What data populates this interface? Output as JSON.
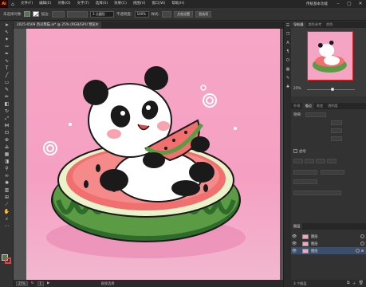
{
  "app": {
    "logo": "Ai"
  },
  "menu": {
    "items": [
      "文件(F)",
      "编辑(E)",
      "对象(O)",
      "文字(T)",
      "选择(S)",
      "效果(C)",
      "视图(V)",
      "窗口(W)",
      "帮助(H)"
    ],
    "workspace": "传统基本功能"
  },
  "controlbar": {
    "selection": "未选择对象",
    "stroke_label": "描边:",
    "brush": "3 点圆形",
    "opacity_label": "不透明度:",
    "opacity": "100%",
    "style_label": "样式:",
    "doc_setup": "文档设置",
    "prefs": "首选项"
  },
  "document": {
    "tab_title": "2025-0509 西瓜熊猫.ai* @ 25% (RGB/GPU 预览)",
    "zoom": "25%",
    "status_tool": "直接选择",
    "page": "1"
  },
  "panels": {
    "navigator_tabs": [
      "导航器",
      "颜色参考",
      "颜色"
    ],
    "navigator_zoom": "25%",
    "stroke_tabs": [
      "外观",
      "描边",
      "渐变",
      "透明度"
    ],
    "stroke_weight_label": "粗细:",
    "stroke_section": "虚线",
    "layers_title": "图层",
    "layers": [
      {
        "name": "图层"
      },
      {
        "name": "图层"
      },
      {
        "name": "图层"
      }
    ],
    "layers_count": "3 个图层"
  },
  "colors": {
    "bg_pink": "#f5a0c2",
    "panda_white": "#ffffff",
    "panda_black": "#1a1a1a",
    "watermelon_red": "#f26f6f",
    "watermelon_green": "#4b8a3c"
  }
}
